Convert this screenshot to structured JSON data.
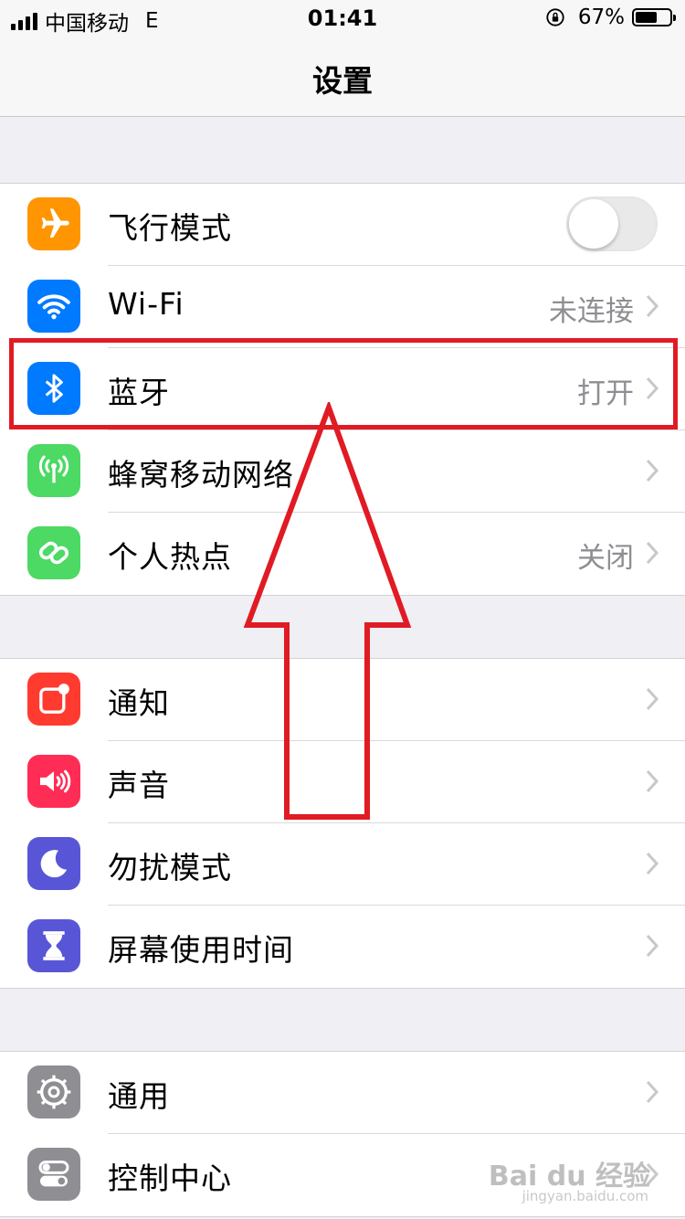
{
  "status_bar": {
    "carrier": "中国移动",
    "network": "E",
    "time": "01:41",
    "battery_percent_label": "67%",
    "battery_level": 0.67
  },
  "nav": {
    "title": "设置"
  },
  "groups": [
    {
      "items": [
        {
          "label": "飞行模式",
          "icon": "airplane-icon",
          "icon_color": "#ff9500",
          "toggle": false
        },
        {
          "label": "Wi-Fi",
          "icon": "wifi-icon",
          "icon_color": "#007aff",
          "value": "未连接"
        },
        {
          "label": "蓝牙",
          "icon": "bluetooth-icon",
          "icon_color": "#007aff",
          "value": "打开"
        },
        {
          "label": "蜂窝移动网络",
          "icon": "cellular-icon",
          "icon_color": "#4cd964",
          "value": ""
        },
        {
          "label": "个人热点",
          "icon": "hotspot-icon",
          "icon_color": "#4cd964",
          "value": "关闭"
        }
      ]
    },
    {
      "items": [
        {
          "label": "通知",
          "icon": "notifications-icon",
          "icon_color": "#ff3b30"
        },
        {
          "label": "声音",
          "icon": "sound-icon",
          "icon_color": "#ff2d55"
        },
        {
          "label": "勿扰模式",
          "icon": "moon-icon",
          "icon_color": "#5856d6"
        },
        {
          "label": "屏幕使用时间",
          "icon": "hourglass-icon",
          "icon_color": "#5856d6"
        }
      ]
    },
    {
      "items": [
        {
          "label": "通用",
          "icon": "gear-icon",
          "icon_color": "#8e8e93"
        },
        {
          "label": "控制中心",
          "icon": "control-center-icon",
          "icon_color": "#8e8e93"
        }
      ]
    }
  ],
  "annotation": {
    "highlight_color": "#e01b24"
  },
  "watermark": {
    "text": "Bai du 经验",
    "sub": "jingyan.baidu.com"
  }
}
